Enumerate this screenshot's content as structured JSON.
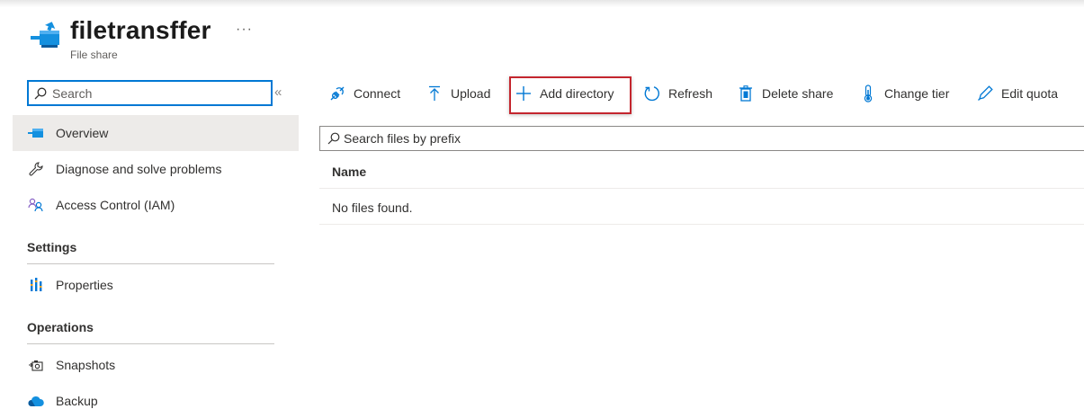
{
  "header": {
    "title": "filetransffer",
    "subtitle": "File share",
    "more_label": "···"
  },
  "sidebar": {
    "search_placeholder": "Search",
    "collapse_label": "«",
    "items": [
      {
        "label": "Overview",
        "icon": "file-share-icon",
        "active": true
      },
      {
        "label": "Diagnose and solve problems",
        "icon": "wrench-icon"
      },
      {
        "label": "Access Control (IAM)",
        "icon": "people-icon"
      }
    ],
    "sections": [
      {
        "title": "Settings",
        "items": [
          {
            "label": "Properties",
            "icon": "properties-icon"
          }
        ]
      },
      {
        "title": "Operations",
        "items": [
          {
            "label": "Snapshots",
            "icon": "snapshot-icon"
          },
          {
            "label": "Backup",
            "icon": "backup-cloud-icon"
          }
        ]
      }
    ]
  },
  "toolbar": {
    "connect": "Connect",
    "upload": "Upload",
    "add_directory": "Add directory",
    "refresh": "Refresh",
    "delete_share": "Delete share",
    "change_tier": "Change tier",
    "edit_quota": "Edit quota"
  },
  "main": {
    "search_placeholder": "Search files by prefix",
    "columns": [
      "Name"
    ],
    "empty_message": "No files found."
  },
  "colors": {
    "accent": "#0078d4",
    "highlight_border": "#c4262e",
    "active_bg": "#edebe9"
  }
}
